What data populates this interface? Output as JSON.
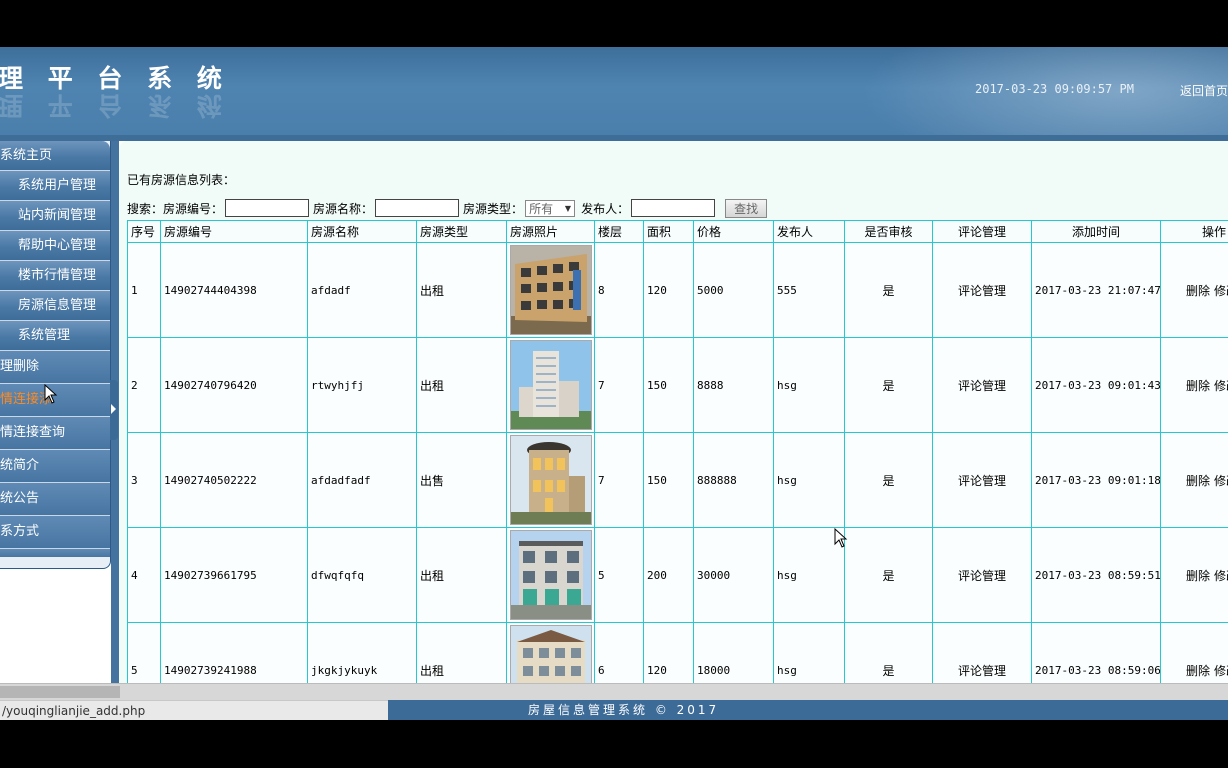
{
  "header": {
    "title": "理 平 台 系 统",
    "datetime": "2017-03-23 09:09:57 PM",
    "home_link": "返回首页"
  },
  "sidebar": {
    "items": [
      {
        "label": "系统主页"
      },
      {
        "label": "系统用户管理"
      },
      {
        "label": "站内新闻管理"
      },
      {
        "label": "帮助中心管理"
      },
      {
        "label": "楼市行情管理"
      },
      {
        "label": "房源信息管理"
      },
      {
        "label": "系统管理"
      },
      {
        "label": "理删除"
      },
      {
        "label": "情连接添"
      },
      {
        "label": "情连接查询"
      },
      {
        "label": "统简介"
      },
      {
        "label": "统公告"
      },
      {
        "label": "系方式"
      }
    ]
  },
  "main": {
    "list_title": "已有房源信息列表：",
    "search": {
      "prefix": "搜索：",
      "id_label": "房源编号：",
      "name_label": "房源名称：",
      "type_label": "房源类型：",
      "type_selected": "所有",
      "publisher_label": "发布人：",
      "button": "查找"
    },
    "table": {
      "headers": [
        "序号",
        "房源编号",
        "房源名称",
        "房源类型",
        "房源照片",
        "楼层",
        "面积",
        "价格",
        "发布人",
        "是否审核",
        "评论管理",
        "添加时间",
        "操作"
      ],
      "rows": [
        {
          "no": "1",
          "code": "14902744404398",
          "name": "afdadf",
          "type": "出租",
          "floor": "8",
          "area": "120",
          "price": "5000",
          "publisher": "555",
          "approved": "是",
          "comment": "评论管理",
          "time": "2017-03-23 21:07:47",
          "delete": "删除",
          "edit": "修改"
        },
        {
          "no": "2",
          "code": "14902740796420",
          "name": "rtwyhjfj",
          "type": "出租",
          "floor": "7",
          "area": "150",
          "price": "8888",
          "publisher": "hsg",
          "approved": "是",
          "comment": "评论管理",
          "time": "2017-03-23 09:01:43",
          "delete": "删除",
          "edit": "修改"
        },
        {
          "no": "3",
          "code": "14902740502222",
          "name": "afdadfadf",
          "type": "出售",
          "floor": "7",
          "area": "150",
          "price": "888888",
          "publisher": "hsg",
          "approved": "是",
          "comment": "评论管理",
          "time": "2017-03-23 09:01:18",
          "delete": "删除",
          "edit": "修改"
        },
        {
          "no": "4",
          "code": "14902739661795",
          "name": "dfwqfqfq",
          "type": "出租",
          "floor": "5",
          "area": "200",
          "price": "30000",
          "publisher": "hsg",
          "approved": "是",
          "comment": "评论管理",
          "time": "2017-03-23 08:59:51",
          "delete": "删除",
          "edit": "修改"
        },
        {
          "no": "5",
          "code": "14902739241988",
          "name": "jkgkjykuyk",
          "type": "出租",
          "floor": "6",
          "area": "120",
          "price": "18000",
          "publisher": "hsg",
          "approved": "是",
          "comment": "评论管理",
          "time": "2017-03-23 08:59:06",
          "delete": "删除",
          "edit": "修改"
        }
      ]
    }
  },
  "statusbar": {
    "url": "/youqinglianjie_add.php"
  },
  "footer": {
    "copyright": "房屋信息管理系统 © 2017"
  },
  "colors": {
    "header": "#4a7eab",
    "sidebar": "#4b79a6",
    "table_border": "#25c8d0",
    "active_text": "#ff8a1f",
    "content_bg": "#f1fbf8"
  }
}
